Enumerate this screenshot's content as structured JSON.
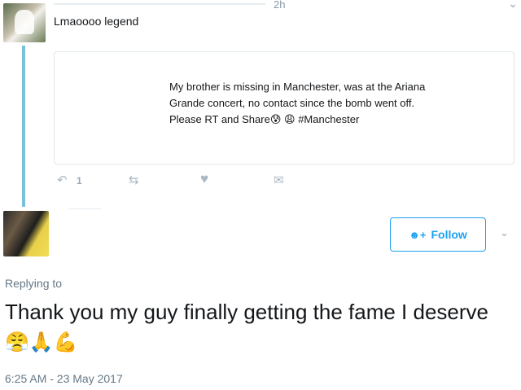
{
  "top_tweet": {
    "time": "2h",
    "text": "Lmaoooo legend",
    "quote": {
      "line1": "My brother is missing in Manchester, was at the Ariana",
      "line2": "Grande concert, no contact since the bomb went off.",
      "line3_prefix": "Please RT and Share",
      "emoji1": "😰",
      "emoji2": "😩",
      "hashtag": "#Manchester"
    },
    "actions": {
      "reply_icon": "reply-icon",
      "reply_count": "1",
      "retweet_icon": "retweet-icon",
      "like_icon": "heart-icon",
      "dm_icon": "direct-message-icon"
    }
  },
  "main_tweet": {
    "follow_label": "Follow",
    "replying_to": "Replying to",
    "text": "Thank you my guy finally getting the fame I deserve",
    "emojis": [
      "😤",
      "🙏",
      "💪"
    ],
    "timestamp": "6:25 AM - 23 May 2017"
  },
  "colors": {
    "accent": "#1da1f2",
    "thread_line": "#7ac0d9",
    "muted": "#657786"
  }
}
